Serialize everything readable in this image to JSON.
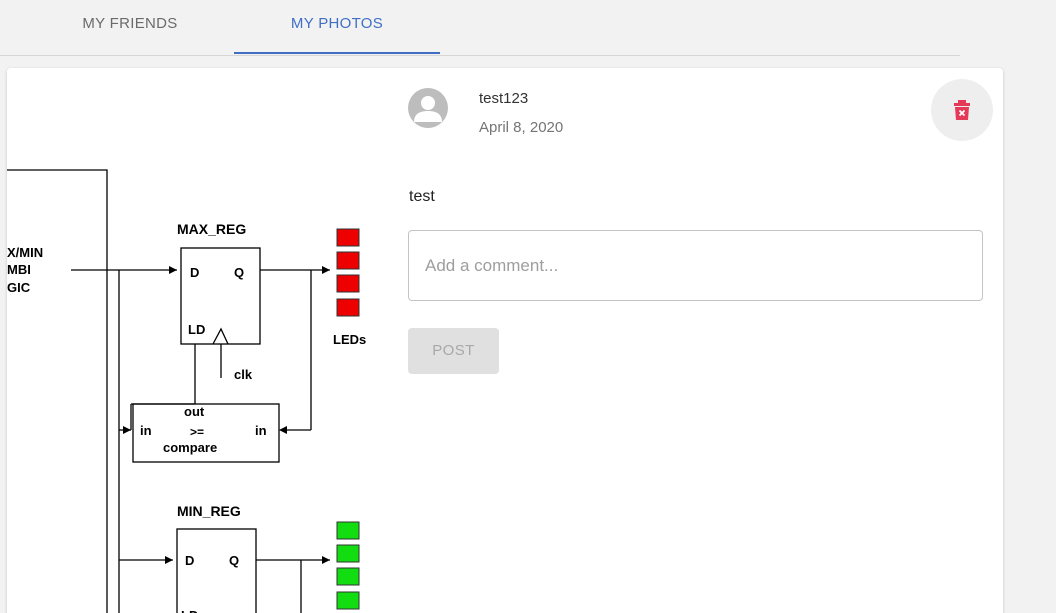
{
  "tabs": [
    {
      "label": "MY FRIENDS",
      "active": false
    },
    {
      "label": "MY PHOTOS",
      "active": true
    }
  ],
  "accent_color": "#3f6fc4",
  "delete_color": "#e53958",
  "post": {
    "username": "test123",
    "date": "April 8, 2020",
    "caption": "test",
    "avatar_icon": "person-icon",
    "delete_icon": "trash-icon"
  },
  "comment": {
    "placeholder": "Add a comment...",
    "value": ""
  },
  "post_button_label": "POST",
  "photo": {
    "block_label_lines": [
      "X/MIN",
      "MBI",
      "GIC"
    ],
    "max_reg_label": "MAX_REG",
    "min_reg_label": "MIN_REG",
    "d_label": "D",
    "q_label": "Q",
    "ld_label": "LD",
    "leds_label": "LEDs",
    "clk_label": "clk",
    "compare_out": "out",
    "compare_in_left": "in",
    "compare_in_right": "in",
    "compare_op": ">=",
    "compare_label": "compare",
    "max_led_color": "#ee0000",
    "min_led_color": "#11dd11"
  }
}
